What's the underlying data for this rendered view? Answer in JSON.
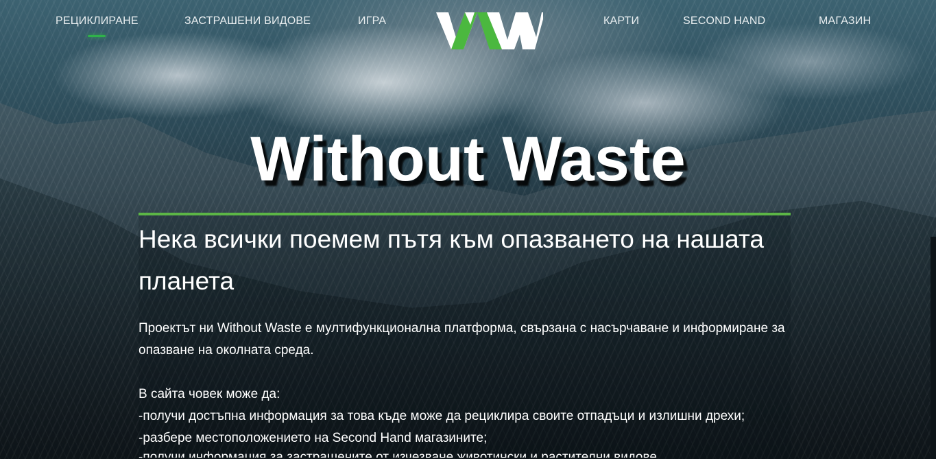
{
  "nav": {
    "left": [
      {
        "label": "РЕЦИКЛИРАНЕ",
        "active": true
      },
      {
        "label": "ЗАСТРАШЕНИ ВИДОВЕ",
        "active": false
      },
      {
        "label": "ИГРА",
        "active": false
      }
    ],
    "right": [
      {
        "label": "КАРТИ",
        "active": false
      },
      {
        "label": "SECOND HAND",
        "active": false
      },
      {
        "label": "МАГАЗИН",
        "active": false
      }
    ],
    "logo_icon": "ww-logo-icon",
    "accent_color": "#2fb24a"
  },
  "hero": {
    "title": "Without Waste",
    "subtitle": "Нека всички поемем пътя към опазването на нашата планета",
    "divider_color": "#5cb646"
  },
  "content": {
    "intro": "Проектът ни Without Waste е мултифункционална платформа, свързана с насърчаване и информиране за опазване на околната среда.",
    "list_heading": "В сайта човек може да:",
    "items": [
      "-получи достъпна информация за това къде може да рециклира своите отпадъци и излишни дрехи;",
      "-разбере местоположението на Second Hand магазините;",
      "-получи информация за застрашените от изчезване животински и растителни видове."
    ]
  }
}
